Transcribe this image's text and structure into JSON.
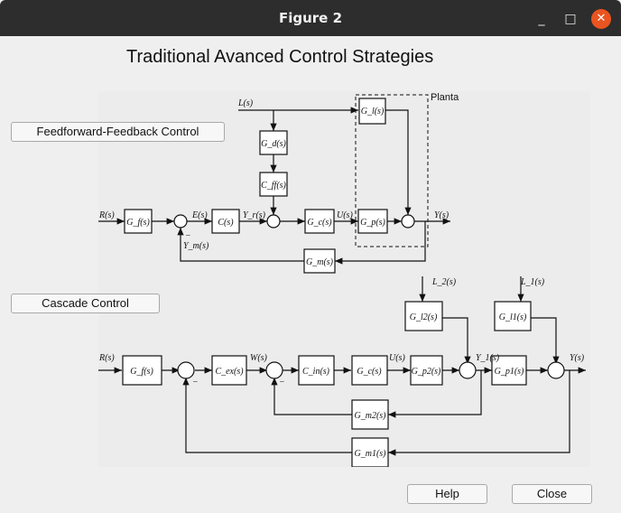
{
  "window": {
    "title": "Figure 2"
  },
  "heading": "Traditional Avanced Control Strategies",
  "buttons": {
    "feedforward": "Feedforward-Feedback Control",
    "cascade": "Cascade Control",
    "help": "Help",
    "close": "Close"
  },
  "diagram1": {
    "plant_label": "Planta",
    "blocks": {
      "gl": "G_l(s)",
      "gd": "G_d(s)",
      "cff": "C_ff(s)",
      "gf": "G_f(s)",
      "c": "C(s)",
      "gc": "G_c(s)",
      "gp": "G_p(s)",
      "gm": "G_m(s)"
    },
    "signals": {
      "L": "L(s)",
      "R": "R(s)",
      "E": "E(s)",
      "Yr": "Y_r(s)",
      "U": "U(s)",
      "Y": "Y(s)",
      "Ym": "Y_m(s)",
      "minus": "−"
    }
  },
  "diagram2": {
    "blocks": {
      "gl2": "G_l2(s)",
      "gl1": "G_l1(s)",
      "gf": "G_f(s)",
      "cex": "C_ex(s)",
      "cin": "C_in(s)",
      "gc": "G_c(s)",
      "gp2": "G_p2(s)",
      "gp1": "G_p1(s)",
      "gm2": "G_m2(s)",
      "gm1": "G_m1(s)"
    },
    "signals": {
      "L2": "L_2(s)",
      "L1": "L_1(s)",
      "R": "R(s)",
      "W": "W(s)",
      "U": "U(s)",
      "Y1": "Y_1(s)",
      "Y": "Y(s)",
      "minus": "−"
    }
  }
}
